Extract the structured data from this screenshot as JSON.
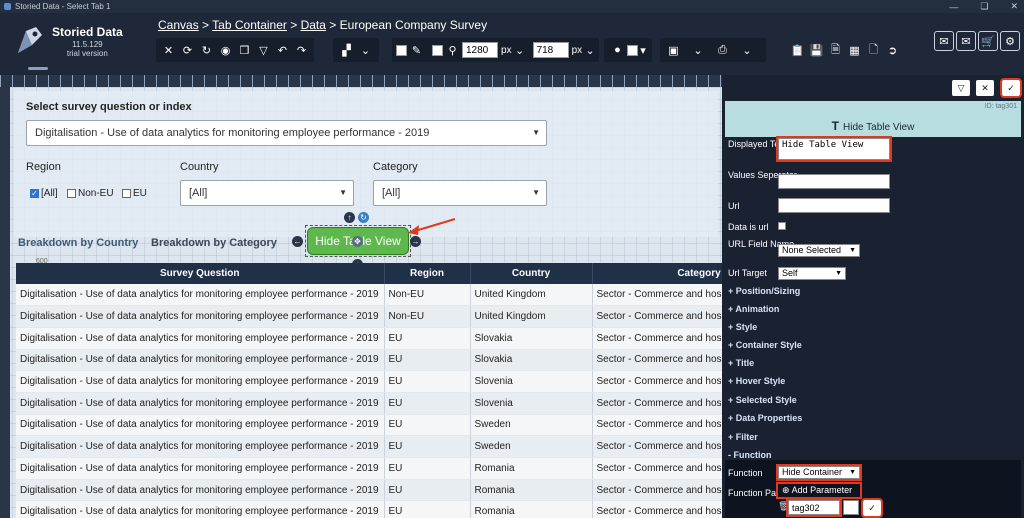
{
  "window": {
    "title": "Storied Data - Select Tab 1"
  },
  "brand": {
    "name": "Storied Data",
    "version": "11.5.129",
    "license": "trial version"
  },
  "breadcrumb": {
    "canvas": "Canvas",
    "tab_container": "Tab Container",
    "data": "Data",
    "current": "European Company Survey",
    "sep": ">"
  },
  "toolbar": {
    "width_value": "1280",
    "height_value": "718",
    "unit": "px"
  },
  "canvas": {
    "question_label": "Select survey question or index",
    "question_value": "Digitalisation - Use of data analytics for monitoring employee performance - 2019",
    "region_label": "Region",
    "region_options": [
      {
        "label": "[All]",
        "checked": true
      },
      {
        "label": "Non-EU",
        "checked": false
      },
      {
        "label": "EU",
        "checked": false
      }
    ],
    "country_label": "Country",
    "country_value": "[All]",
    "category_label": "Category",
    "category_value": "[All]",
    "tabs": [
      "Breakdown by Country",
      "Breakdown by Category"
    ],
    "toggle_button": "Hide Table View",
    "axis_peek": "600"
  },
  "table": {
    "headers": [
      "Survey Question",
      "Region",
      "Country",
      "Category"
    ],
    "rows": [
      [
        "Digitalisation - Use of data analytics for monitoring employee performance - 2019",
        "Non-EU",
        "United Kingdom",
        "Sector - Commerce and hospitality"
      ],
      [
        "Digitalisation - Use of data analytics for monitoring employee performance - 2019",
        "Non-EU",
        "United Kingdom",
        "Sector - Commerce and hospitality"
      ],
      [
        "Digitalisation - Use of data analytics for monitoring employee performance - 2019",
        "EU",
        "Slovakia",
        "Sector - Commerce and hospitality"
      ],
      [
        "Digitalisation - Use of data analytics for monitoring employee performance - 2019",
        "EU",
        "Slovakia",
        "Sector - Commerce and hospitality"
      ],
      [
        "Digitalisation - Use of data analytics for monitoring employee performance - 2019",
        "EU",
        "Slovenia",
        "Sector - Commerce and hospitality"
      ],
      [
        "Digitalisation - Use of data analytics for monitoring employee performance - 2019",
        "EU",
        "Slovenia",
        "Sector - Commerce and hospitality"
      ],
      [
        "Digitalisation - Use of data analytics for monitoring employee performance - 2019",
        "EU",
        "Sweden",
        "Sector - Commerce and hospitality"
      ],
      [
        "Digitalisation - Use of data analytics for monitoring employee performance - 2019",
        "EU",
        "Sweden",
        "Sector - Commerce and hospitality"
      ],
      [
        "Digitalisation - Use of data analytics for monitoring employee performance - 2019",
        "EU",
        "Romania",
        "Sector - Commerce and hospitality"
      ],
      [
        "Digitalisation - Use of data analytics for monitoring employee performance - 2019",
        "EU",
        "Romania",
        "Sector - Commerce and hospitality"
      ],
      [
        "Digitalisation - Use of data analytics for monitoring employee performance - 2019",
        "EU",
        "Romania",
        "Sector - Commerce and hospitality"
      ]
    ]
  },
  "properties": {
    "id": "ID: tag301",
    "title": "Hide Table View",
    "displayed_text_label": "Displayed Text",
    "displayed_text_value": "Hide Table View",
    "values_separator_label": "Values Seperator",
    "url_label": "Url",
    "data_is_url_label": "Data is url",
    "url_field_label": "URL Field Name",
    "url_field_value": "None Selected",
    "url_target_label": "Url Target",
    "url_target_value": "Self",
    "sections": [
      "+ Position/Sizing",
      "+ Animation",
      "+ Style",
      "+ Container Style",
      "+ Title",
      "+ Hover Style",
      "+ Selected Style",
      "+ Data Properties",
      "+ Filter",
      "- Function"
    ],
    "function_label": "Function",
    "function_value": "Hide Container",
    "function_parms_label": "Function Parms",
    "add_parameter": "Add Parameter",
    "param_value": "tag302"
  },
  "colors": {
    "accent_green": "#5fb84d",
    "highlight": "#e03a1e",
    "header_bg": "#1f2838",
    "panel_head": "#b8dde0"
  }
}
